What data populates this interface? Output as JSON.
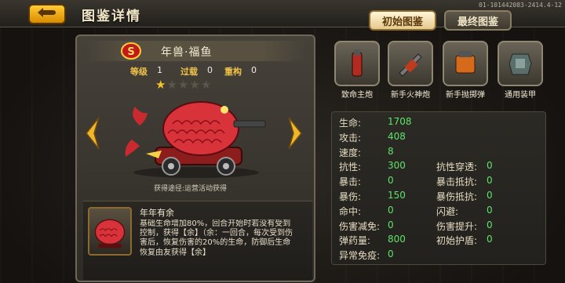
{
  "header": {
    "title": "图鉴详情",
    "meta_text": "01-101442083-2414.4-12"
  },
  "tabs": {
    "initial_label": "初始图鉴",
    "final_label": "最终图鉴"
  },
  "unit": {
    "name": "年兽·福鱼",
    "badge_letter": "S",
    "level_label": "等级",
    "level_value": "1",
    "overload_label": "过载",
    "overload_value": "0",
    "rebuild_label": "重构",
    "rebuild_value": "0",
    "stars": {
      "filled": 1,
      "total": 5
    },
    "origin_text": "获得途径:运营活动获得"
  },
  "skill": {
    "name": "年年有余",
    "description": "基础生命增加80%，回合开始时若没有受到控制，获得【余】（余：一回合，每次受到伤害后，恢复伤害的20%的生命，防御后生命恢复由友获得【余】"
  },
  "equipment": [
    {
      "label": "致命主炮",
      "icon": "cannon-icon"
    },
    {
      "label": "新手火神炮",
      "icon": "gatling-icon"
    },
    {
      "label": "新手抛掷弹",
      "icon": "grenade-launcher-icon"
    },
    {
      "label": "通用装甲",
      "icon": "armor-icon"
    }
  ],
  "attributes_left": [
    {
      "label": "生命:",
      "value": "1708"
    },
    {
      "label": "攻击:",
      "value": "408"
    },
    {
      "label": "速度:",
      "value": "8"
    },
    {
      "label": "抗性:",
      "value": "300"
    },
    {
      "label": "暴击:",
      "value": "0"
    },
    {
      "label": "暴伤:",
      "value": "150"
    },
    {
      "label": "命中:",
      "value": "0"
    },
    {
      "label": "伤害减免:",
      "value": "0"
    },
    {
      "label": "弹药量:",
      "value": "800"
    },
    {
      "label": "异常免疫:",
      "value": "0"
    }
  ],
  "attributes_right": [
    {
      "label": "抗性穿透:",
      "value": "0"
    },
    {
      "label": "暴击抵抗:",
      "value": "0"
    },
    {
      "label": "暴伤抵抗:",
      "value": "0"
    },
    {
      "label": "闪避:",
      "value": "0"
    },
    {
      "label": "伤害提升:",
      "value": "0"
    },
    {
      "label": "初始护盾:",
      "value": "0"
    }
  ],
  "colors": {
    "accent": "#f4c32a",
    "value_green": "#5fe36a",
    "label_gold": "#f0c24a"
  }
}
